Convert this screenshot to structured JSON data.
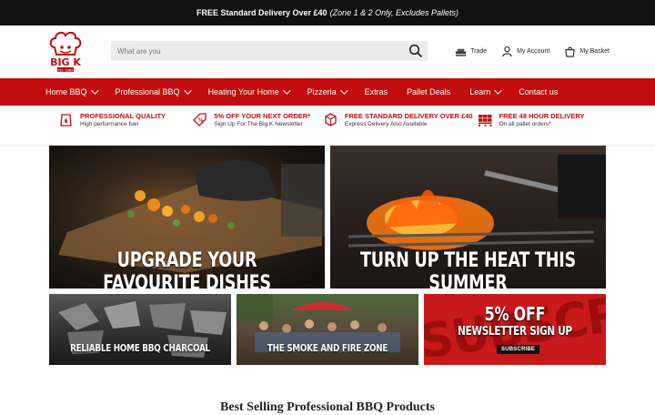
{
  "topbar": {
    "strong": "FREE Standard Delivery Over £40",
    "italic": "(Zone 1 & 2 Only, Excludes Pallets)"
  },
  "logo": {
    "text": "BIG K",
    "est": "Est. 1983"
  },
  "search": {
    "placeholder": "What are you"
  },
  "header_links": [
    {
      "label": "Trade",
      "icon": "pallet-icon"
    },
    {
      "label": "My Account",
      "icon": "user-icon"
    },
    {
      "label": "My Basket",
      "icon": "basket-icon"
    }
  ],
  "nav": [
    {
      "label": "Home BBQ",
      "dropdown": true
    },
    {
      "label": "Professional BBQ",
      "dropdown": true
    },
    {
      "label": "Heating Your Home",
      "dropdown": true
    },
    {
      "label": "Pizzeria",
      "dropdown": true
    },
    {
      "label": "Extras",
      "dropdown": false
    },
    {
      "label": "Pallet Deals",
      "dropdown": false
    },
    {
      "label": "Learn",
      "dropdown": true
    },
    {
      "label": "Contact us",
      "dropdown": false
    }
  ],
  "usps": [
    {
      "title": "PROFESSIONAL QUALITY",
      "sub": "High performance fuel",
      "icon": "fuel-bag-icon"
    },
    {
      "title": "5% OFF YOUR NEXT ORDER*",
      "sub": "Sign Up For The Big K Newsletter",
      "icon": "discount-tag-icon"
    },
    {
      "title": "FREE STANDARD DELIVERY OVER £40",
      "sub": "Express Delivery Also Available",
      "icon": "delivery-box-icon"
    },
    {
      "title": "FREE 48 HOUR DELIVERY",
      "sub": "On all pallet orders*",
      "icon": "pallet-stack-icon"
    }
  ],
  "tiles": [
    {
      "caption": "UPGRADE YOUR FAVOURITE DISHES"
    },
    {
      "caption": "TURN UP THE HEAT THIS SUMMER"
    },
    {
      "caption": "RELIABLE HOME BBQ CHARCOAL"
    },
    {
      "caption": "THE SMOKE AND FIRE ZONE"
    },
    {
      "caption1": "5% OFF",
      "caption2": "NEWSLETTER SIGN UP",
      "button": "SUBSCRIBE",
      "bgtext": "SUBSCRIBE"
    }
  ],
  "section_heading": "Best Selling Professional BBQ Products",
  "colors": {
    "brand_red": "#c10d0d",
    "topbar": "#111111"
  }
}
